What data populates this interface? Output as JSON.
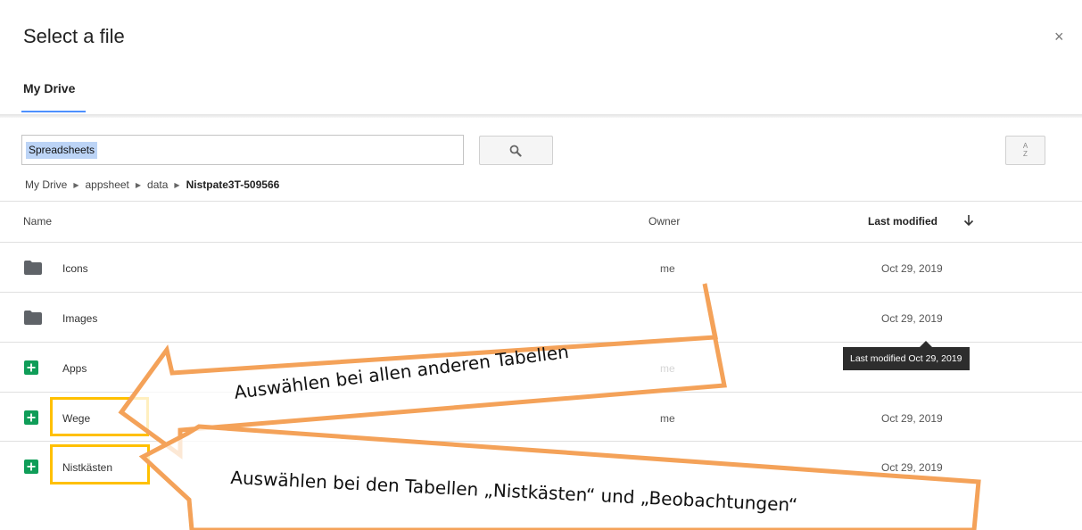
{
  "dialog": {
    "title": "Select a file",
    "close_glyph": "×"
  },
  "tabs": [
    {
      "label": "My Drive",
      "active": true
    }
  ],
  "search": {
    "value": "Spreadsheets",
    "button_icon": "search-icon",
    "sort_icon": "sort-az-icon"
  },
  "breadcrumb": [
    "My Drive",
    "appsheet",
    "data",
    "Nistpate3T-509566"
  ],
  "table": {
    "headers": {
      "name": "Name",
      "owner": "Owner",
      "modified": "Last modified"
    },
    "sort": {
      "column": "Last modified",
      "direction": "descending"
    },
    "rows": [
      {
        "name": "Icons",
        "type": "folder",
        "owner": "me",
        "modified": "Oct 29, 2019"
      },
      {
        "name": "Images",
        "type": "folder",
        "owner": "",
        "modified": "Oct 29, 2019"
      },
      {
        "name": "Apps",
        "type": "spreadsheet",
        "owner": "me",
        "modified": ""
      },
      {
        "name": "Wege",
        "type": "spreadsheet",
        "owner": "me",
        "modified": "Oct 29, 2019"
      },
      {
        "name": "Nistkästen",
        "type": "spreadsheet",
        "owner": "",
        "modified": "Oct 29, 2019"
      }
    ]
  },
  "tooltip": "Last modified Oct 29, 2019",
  "annotations": {
    "top_text": "Auswählen bei allen anderen Tabellen",
    "bottom_text": "Auswählen bei den Tabellen „Nistkästen“ und „Beobachtungen“"
  },
  "colors": {
    "arrow_stroke": "#f4a259",
    "highlight_box": "#ffc000",
    "sheet_icon": "#0f9d58",
    "folder_icon": "#5f6368",
    "tab_underline": "#4d90fe"
  }
}
